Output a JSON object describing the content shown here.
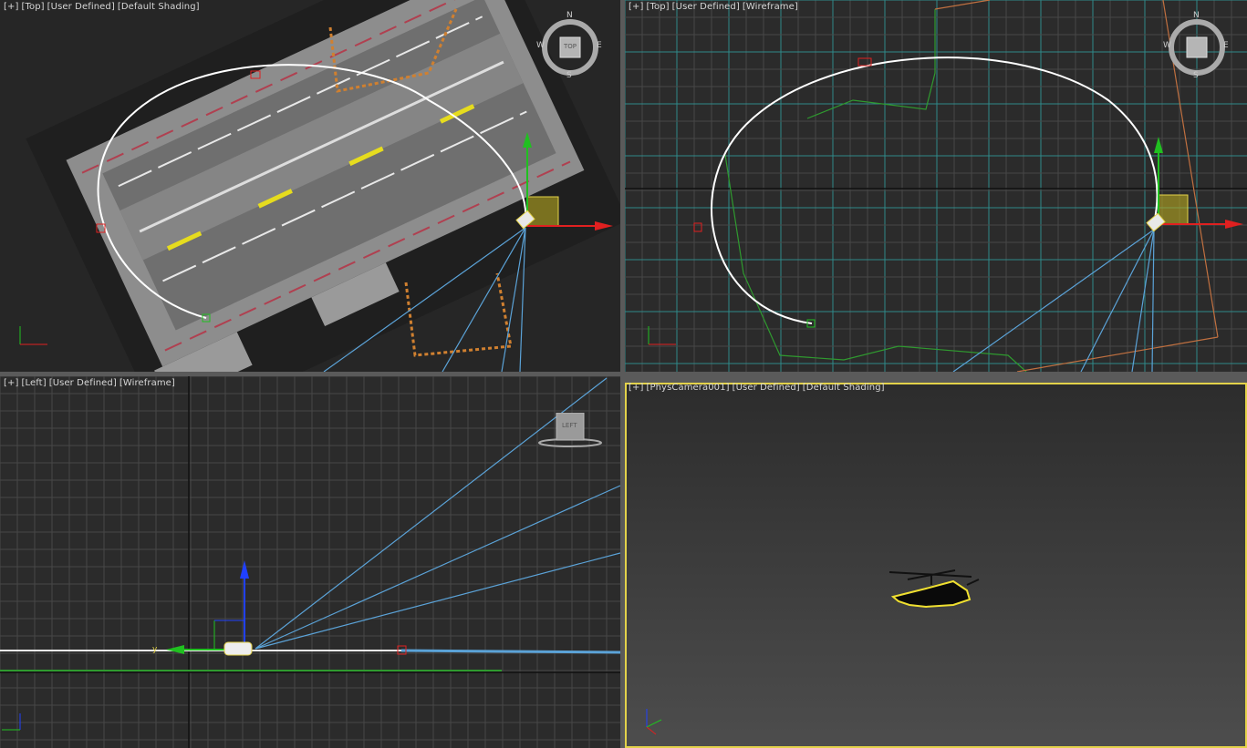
{
  "viewports": {
    "top_shaded": {
      "label_parts": [
        "[+]",
        "[Top]",
        "[User Defined]",
        "[Default Shading]"
      ],
      "viewcube": {
        "face": "TOP",
        "n": "N",
        "s": "S",
        "e": "E",
        "w": "W"
      }
    },
    "top_wireframe": {
      "label_parts": [
        "[+]",
        "[Top]",
        "[User Defined]",
        "[Wireframe]"
      ],
      "viewcube": {
        "n": "N",
        "s": "S",
        "e": "E",
        "w": "W"
      }
    },
    "left_wireframe": {
      "label_parts": [
        "[+]",
        "[Left]",
        "[User Defined]",
        "[Wireframe]"
      ],
      "viewcube": {
        "face": "LEFT"
      }
    },
    "camera": {
      "label_parts": [
        "[+]",
        "[PhysCamera001]",
        "[User Defined]",
        "[Default Shading]"
      ]
    }
  },
  "axes": {
    "x": "x",
    "y": "y",
    "z": "z"
  },
  "colors": {
    "viewport_bg": "#2b2b2b",
    "active_border": "#e3d24a",
    "grid": "#4a4a4a",
    "grid_teal": "#2f8a8a",
    "path": "#ffffff",
    "frustum": "#5ba3d8",
    "axis_x": "#e02020",
    "axis_y": "#20c020",
    "axis_z": "#2040ff",
    "selection": "#f0e030"
  },
  "icons": [
    "viewcube-icon",
    "camera-icon",
    "helicopter-icon",
    "axis-tripod-icon",
    "transform-gizmo-icon"
  ]
}
